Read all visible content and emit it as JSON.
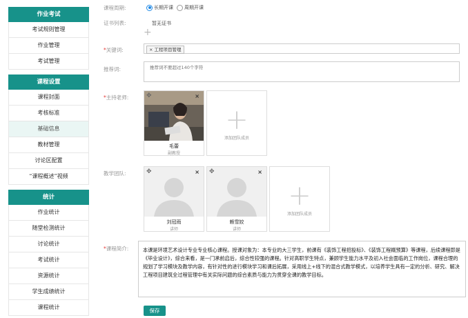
{
  "sidebar": {
    "sections": [
      {
        "title": "作业考试",
        "items": [
          "考试规则管理",
          "作业管理",
          "考试管理"
        ]
      },
      {
        "title": "课程设置",
        "items": [
          "课程封面",
          "考核标准",
          "基础信息",
          "教材管理",
          "讨论区配置",
          "“课程概述”视频"
        ]
      },
      {
        "title": "统计",
        "items": [
          "作业统计",
          "随堂检测统计",
          "讨论统计",
          "考试统计",
          "资源统计",
          "学生成绩统计",
          "课程统计"
        ]
      }
    ],
    "active_item": "基础信息"
  },
  "form": {
    "period": {
      "label": "课程周期:",
      "options": [
        "长期开课",
        "周期开课"
      ],
      "selected": "长期开课"
    },
    "certificates": {
      "label": "证书列表:",
      "value": "暂无证书"
    },
    "keywords": {
      "label": "*关键词:",
      "tag": "工程项目管理"
    },
    "recommend": {
      "label": "推荐词:",
      "placeholder": "推荐词不要超过140个字符"
    },
    "teacher": {
      "label": "*主持老师:",
      "card": {
        "name": "毛蕾",
        "role": "副教授"
      },
      "add_label": "添加团队成员"
    },
    "team": {
      "label": "教学团队:",
      "members": [
        {
          "name": "刘冠雨",
          "role": "讲师"
        },
        {
          "name": "赖雪姣",
          "role": "讲师"
        }
      ],
      "add_label": "添加团队成员"
    },
    "intro": {
      "label": "*课程简介:",
      "text": "本课是环境艺术设计专业专业核心课程。授课对象为：本专业的大三学生，前课有《装饰工程招投标》、《装饰工程概预算》等课程，后续课程即是《毕业设计》，综合来看，是一门承前启后，综合性较强的课程。针对高职学生特点，兼顾学生能力水平及初入社会面临的工作岗位，课程合理的规划了学习模块及教学内容，有针对性的进行模块学习和课后拓展，采用线上+线下的混合式教学模式，以培养学生具有一定的分析、研究、解决工程项目建筑全过程管理中有关实际问题的综合素质与能力为贯穿全课的教学目标。"
    },
    "save_label": "保存"
  }
}
